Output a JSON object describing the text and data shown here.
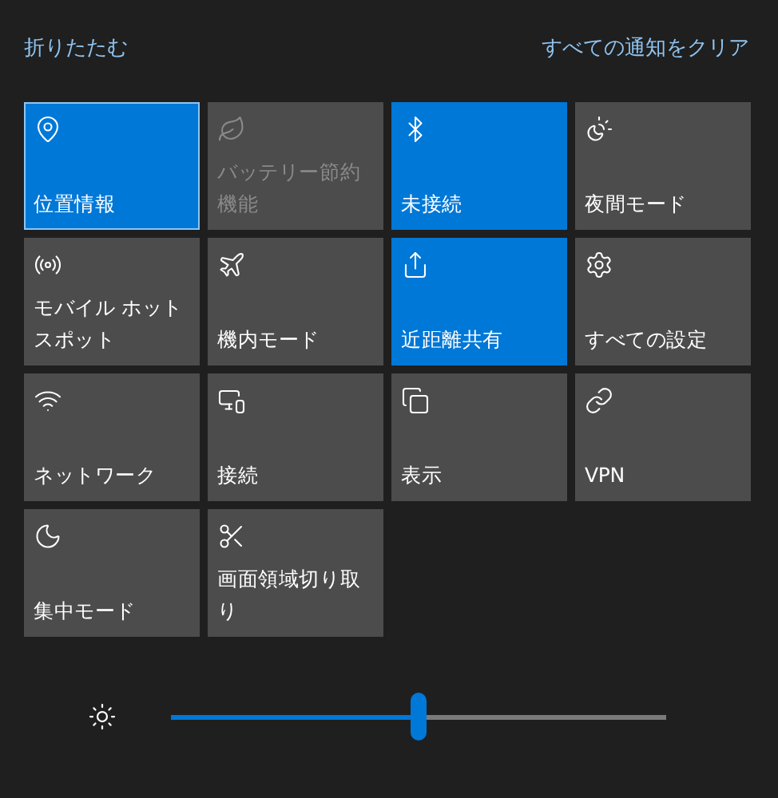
{
  "header": {
    "collapse_link": "折りたたむ",
    "clear_link": "すべての通知をクリア"
  },
  "tiles": [
    {
      "label": "位置情報",
      "on": true,
      "disabled": false,
      "focused": true
    },
    {
      "label": "バッテリー節約機能",
      "on": false,
      "disabled": true,
      "focused": false
    },
    {
      "label": "未接続",
      "on": true,
      "disabled": false,
      "focused": false
    },
    {
      "label": "夜間モード",
      "on": false,
      "disabled": false,
      "focused": false
    },
    {
      "label": "モバイル ホットスポット",
      "on": false,
      "disabled": false,
      "focused": false
    },
    {
      "label": "機内モード",
      "on": false,
      "disabled": false,
      "focused": false
    },
    {
      "label": "近距離共有",
      "on": true,
      "disabled": false,
      "focused": false
    },
    {
      "label": "すべての設定",
      "on": false,
      "disabled": false,
      "focused": false
    },
    {
      "label": "ネットワーク",
      "on": false,
      "disabled": false,
      "focused": false
    },
    {
      "label": "接続",
      "on": false,
      "disabled": false,
      "focused": false
    },
    {
      "label": "表示",
      "on": false,
      "disabled": false,
      "focused": false
    },
    {
      "label": "VPN",
      "on": false,
      "disabled": false,
      "focused": false
    },
    {
      "label": "集中モード",
      "on": false,
      "disabled": false,
      "focused": false
    },
    {
      "label": "画面領域切り取り",
      "on": false,
      "disabled": false,
      "focused": false
    }
  ],
  "brightness": {
    "level": 0.5
  }
}
